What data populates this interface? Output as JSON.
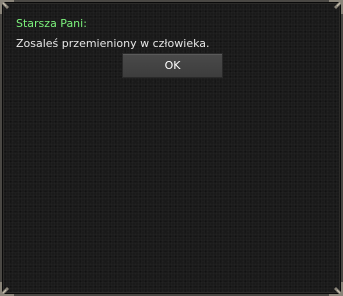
{
  "dialog": {
    "speaker": "Starsza Pani:",
    "message": "Zosaleś przemieniony w człowieka.",
    "ok_label": "OK"
  },
  "colors": {
    "speaker": "#7cf27c",
    "message": "#e6e6e6",
    "background": "#1a1a1a",
    "border": "#4a4844",
    "button": "#444444"
  },
  "icons": [
    "corner-ornament-icon"
  ]
}
